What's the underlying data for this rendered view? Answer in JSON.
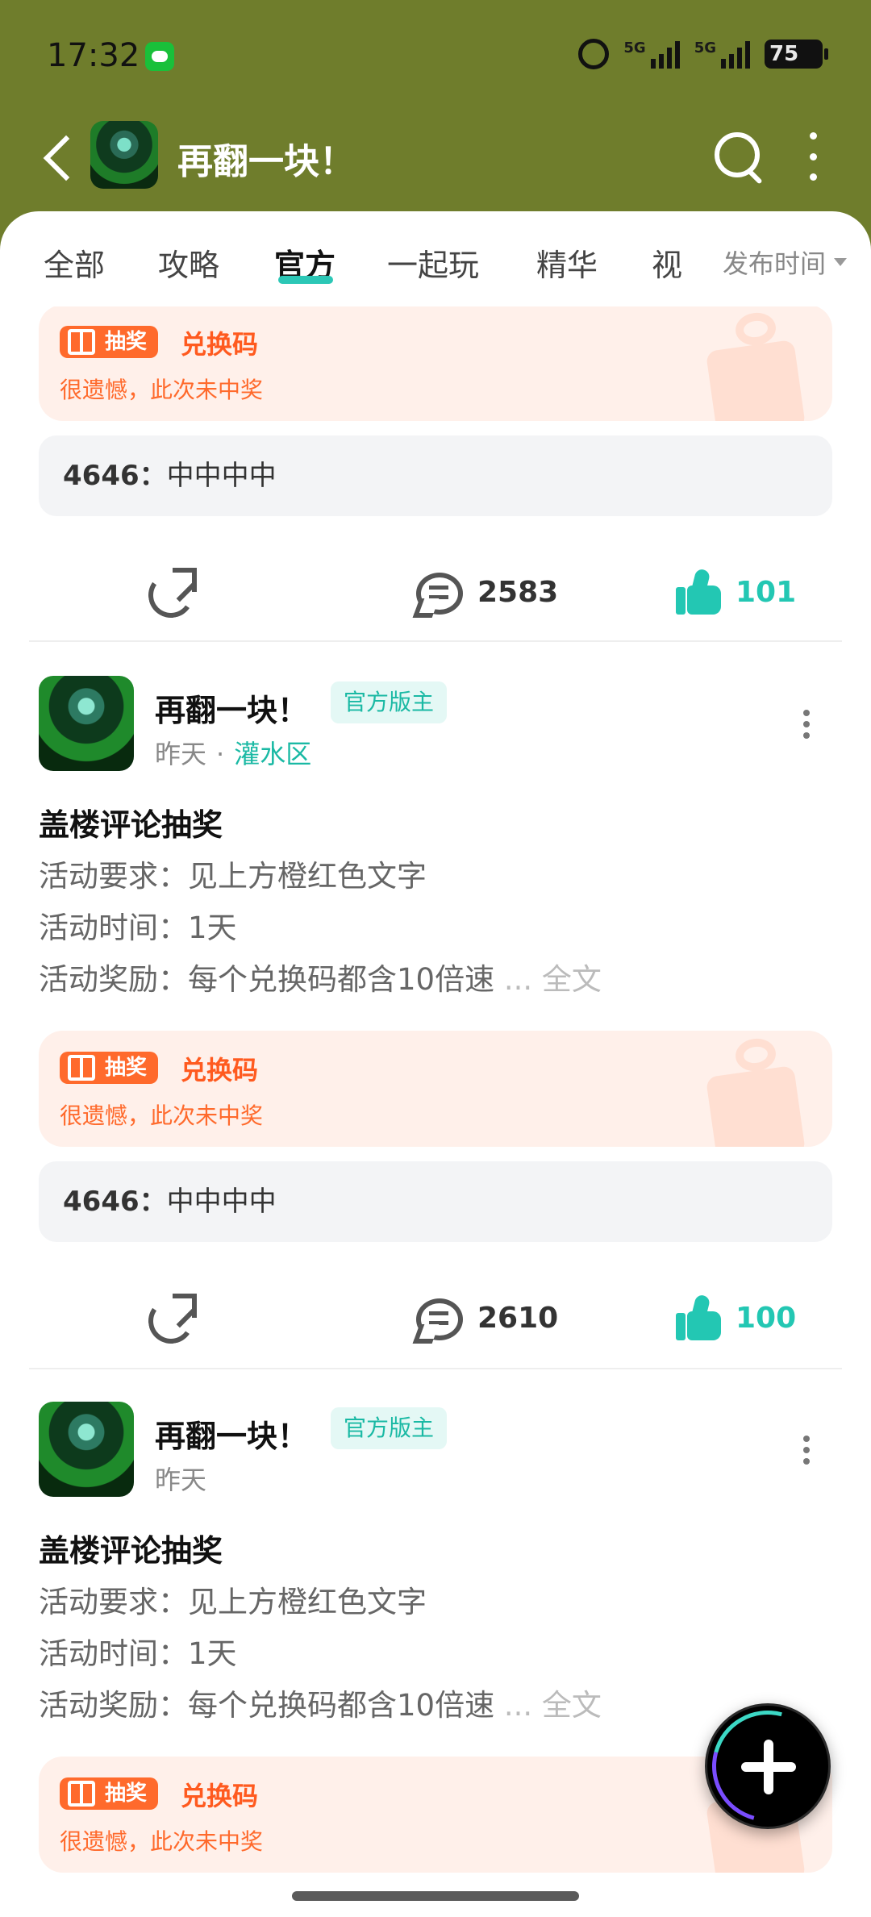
{
  "status_bar": {
    "time": "17:32",
    "battery": "75",
    "signal_1": "5G",
    "signal_2": "5G"
  },
  "header": {
    "title": "再翻一块！"
  },
  "tabs": {
    "items": [
      "全部",
      "攻略",
      "官方",
      "一起玩",
      "精华",
      "视"
    ],
    "active": "官方",
    "sort_label": "发布时间"
  },
  "colors": {
    "header_bg": "#6f7d2c",
    "accent_teal": "#23c7b3",
    "lottery_orange": "#ff6a2c",
    "lottery_bg": "#fff0ea"
  },
  "posts": [
    {
      "lottery": {
        "badge": "抽奖",
        "type": "兑换码",
        "result": "很遗憾，此次未中奖"
      },
      "comment": {
        "author": "4646：",
        "text": "中中中中"
      },
      "actions": {
        "comments": "2583",
        "likes": "101"
      }
    },
    {
      "author": "再翻一块！",
      "badge": "官方版主",
      "time": "昨天",
      "board": "灌水区",
      "title": "盖楼评论抽奖",
      "lines": [
        "活动要求：见上方橙红色文字",
        "活动时间：1天",
        "活动奖励：每个兑换码都含10倍速"
      ],
      "more_label": "... 全文",
      "lottery": {
        "badge": "抽奖",
        "type": "兑换码",
        "result": "很遗憾，此次未中奖"
      },
      "comment": {
        "author": "4646：",
        "text": "中中中中"
      },
      "actions": {
        "comments": "2610",
        "likes": "100"
      }
    },
    {
      "author": "再翻一块！",
      "badge": "官方版主",
      "time": "昨天",
      "title": "盖楼评论抽奖",
      "lines": [
        "活动要求：见上方橙红色文字",
        "活动时间：1天",
        "活动奖励：每个兑换码都含10倍速"
      ],
      "more_label": "... 全文",
      "lottery": {
        "badge": "抽奖",
        "type": "兑换码",
        "result": "很遗憾，此次未中奖"
      }
    }
  ]
}
